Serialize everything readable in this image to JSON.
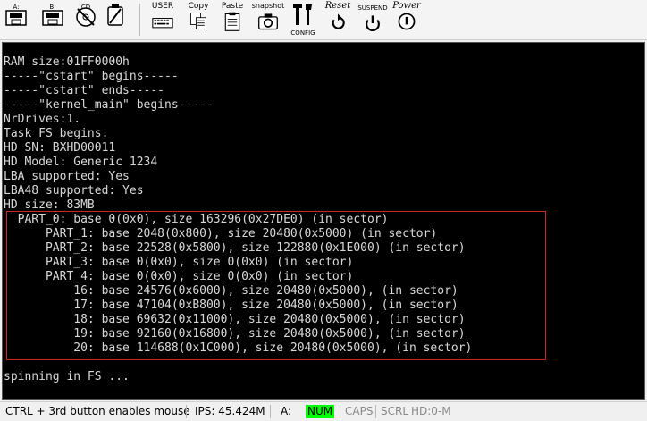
{
  "toolbar": {
    "drive_a": "A:",
    "drive_b": "B:",
    "cd": "CD",
    "usb": "",
    "user": "USER",
    "copy": "Copy",
    "paste": "Paste",
    "snapshot": "snapshot",
    "config": "CONFIG",
    "reset": "Reset",
    "suspend": "SUSPEND",
    "power": "Power"
  },
  "console": {
    "lines": [
      "RAM size:01FF0000h",
      "-----\"cstart\" begins-----",
      "-----\"cstart\" ends-----",
      "-----\"kernel_main\" begins-----",
      "NrDrives:1.",
      "Task FS begins.",
      "HD SN: BXHD00011",
      "HD Model: Generic 1234",
      "LBA supported: Yes",
      "LBA48 supported: Yes",
      "HD size: 83MB",
      "  PART_0: base 0(0x0), size 163296(0x27DE0) (in sector)",
      "      PART_1: base 2048(0x800), size 20480(0x5000) (in sector)",
      "      PART_2: base 22528(0x5800), size 122880(0x1E000) (in sector)",
      "      PART_3: base 0(0x0), size 0(0x0) (in sector)",
      "      PART_4: base 0(0x0), size 0(0x0) (in sector)",
      "          16: base 24576(0x6000), size 20480(0x5000), (in sector)",
      "          17: base 47104(0xB800), size 20480(0x5000), (in sector)",
      "          18: base 69632(0x11000), size 20480(0x5000), (in sector)",
      "          19: base 92160(0x16800), size 20480(0x5000), (in sector)",
      "          20: base 114688(0x1C000), size 20480(0x5000), (in sector)",
      "",
      "spinning in FS ..."
    ]
  },
  "statusbar": {
    "hint": "CTRL + 3rd button enables mouse",
    "ips": "IPS: 45.424M",
    "drive": "A:",
    "num": "NUM",
    "caps": "CAPS",
    "scrl": "SCRL",
    "hd": "HD:0-M"
  }
}
